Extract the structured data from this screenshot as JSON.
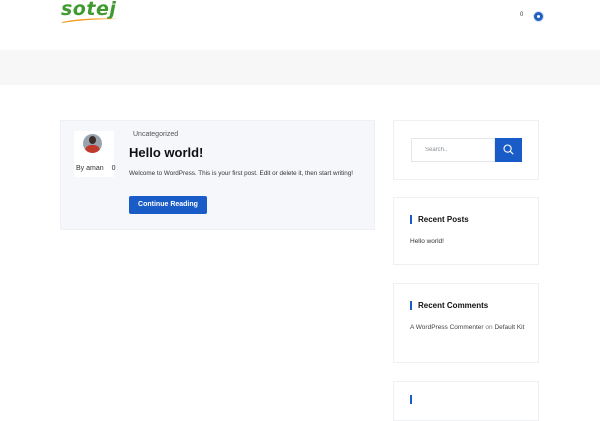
{
  "header": {
    "logo_text": "sotej",
    "cart_count": "0"
  },
  "post": {
    "author_prefix": "By",
    "author_name": "aman",
    "comments_count": "0",
    "category": "Uncategorized",
    "title": "Hello world!",
    "excerpt": "Welcome to WordPress. This is your first post. Edit or delete it, then start writing!",
    "read_more_label": "Continue Reading"
  },
  "sidebar": {
    "search_placeholder": "Search..",
    "recent_posts": {
      "title": "Recent Posts",
      "items": [
        "Hello world!"
      ]
    },
    "recent_comments": {
      "title": "Recent Comments",
      "author": "A WordPress Commenter",
      "on_word": "on",
      "post": "Default Kit"
    }
  },
  "colors": {
    "accent": "#1a5cc7",
    "logo_green": "#3f9b2f",
    "logo_orange": "#f39a1e",
    "band": "#f7f7f7",
    "card_bg": "#f5f7fb"
  },
  "icons": {
    "search_button": "search-icon",
    "user": "user-icon"
  }
}
